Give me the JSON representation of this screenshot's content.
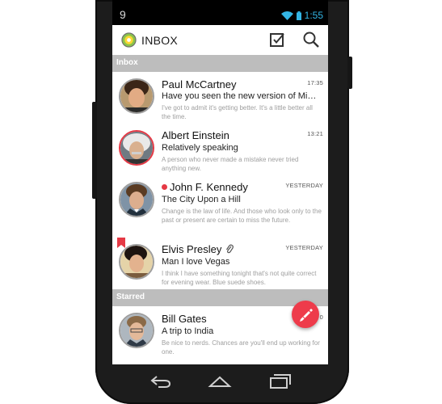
{
  "status": {
    "left_number": "9",
    "time": "1:55"
  },
  "appbar": {
    "title": "INBOX",
    "icons": [
      "check-box-icon",
      "search-icon"
    ]
  },
  "sections": {
    "inbox": "Inbox",
    "starred": "Starred"
  },
  "messages": [
    {
      "sender": "Paul McCartney",
      "time": "17:35",
      "subject": "Have you seen the new version of Mi…",
      "preview": "I've got to admit it's getting better. It's a little better all the time.",
      "unread": false,
      "flagged": false,
      "attachment": false
    },
    {
      "sender": "Albert Einstein",
      "time": "13:21",
      "subject": "Relatively speaking",
      "preview": "A person who never made a mistake never tried anything new.",
      "unread": false,
      "flagged": false,
      "attachment": false
    },
    {
      "sender": "John F. Kennedy",
      "time": "YESTERDAY",
      "subject": "The City Upon a Hill",
      "preview": "Change is the law of life. And those who look only to the past or present are certain to miss the future.",
      "unread": true,
      "flagged": false,
      "attachment": false
    },
    {
      "sender": "Elvis Presley",
      "time": "YESTERDAY",
      "subject": "Man I love Vegas",
      "preview": "I think I have something tonight that's not quite correct for evening wear. Blue suede shoes.",
      "unread": false,
      "flagged": true,
      "attachment": true
    }
  ],
  "starred": [
    {
      "sender": "Bill Gates",
      "time": "0",
      "subject": "A trip to India",
      "preview": "Be nice to nerds. Chances are you'll end up working for one."
    }
  ],
  "colors": {
    "accent": "#ee3b4b",
    "section": "#bdbdbd",
    "holo_blue": "#33b5e5"
  }
}
